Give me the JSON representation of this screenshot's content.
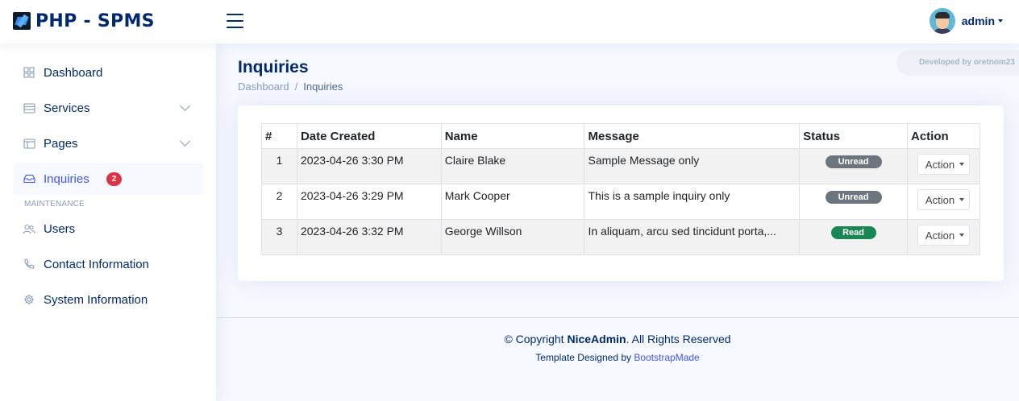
{
  "header": {
    "logo_text": "PHP - SPMS",
    "user_name": "admin"
  },
  "sidebar": {
    "items": [
      {
        "label": "Dashboard"
      },
      {
        "label": "Services"
      },
      {
        "label": "Pages"
      },
      {
        "label": "Inquiries",
        "badge": "2"
      },
      {
        "label": "Users"
      },
      {
        "label": "Contact Information"
      },
      {
        "label": "System Information"
      }
    ],
    "heading": "MAINTENANCE"
  },
  "main": {
    "title": "Inquiries",
    "breadcrumb": [
      "Dashboard",
      "Inquiries"
    ],
    "dev_note": "Developed by oretnom23"
  },
  "table": {
    "headers": [
      "#",
      "Date Created",
      "Name",
      "Message",
      "Status",
      "Action"
    ],
    "rows": [
      {
        "num": "1",
        "date": "2023-04-26 3:30 PM",
        "name": "Claire Blake",
        "message": "Sample Message only",
        "status": "Unread",
        "action": "Action"
      },
      {
        "num": "2",
        "date": "2023-04-26 3:29 PM",
        "name": "Mark Cooper",
        "message": "This is a sample inquiry only",
        "status": "Unread",
        "action": "Action"
      },
      {
        "num": "3",
        "date": "2023-04-26 3:32 PM",
        "name": "George Willson",
        "message": "In aliquam, arcu sed tincidunt porta,...",
        "status": "Read",
        "action": "Action"
      }
    ]
  },
  "footer": {
    "copy_prefix": "© Copyright ",
    "brand": "NiceAdmin",
    "copy_suffix": ". All Rights Reserved",
    "credits_prefix": "Template Designed by ",
    "credits_link": "BootstrapMade"
  },
  "colors": {
    "primary": "#012970",
    "accent": "#4154f1",
    "unread": "#6c757d",
    "read": "#198754",
    "badge": "#dc3545"
  }
}
